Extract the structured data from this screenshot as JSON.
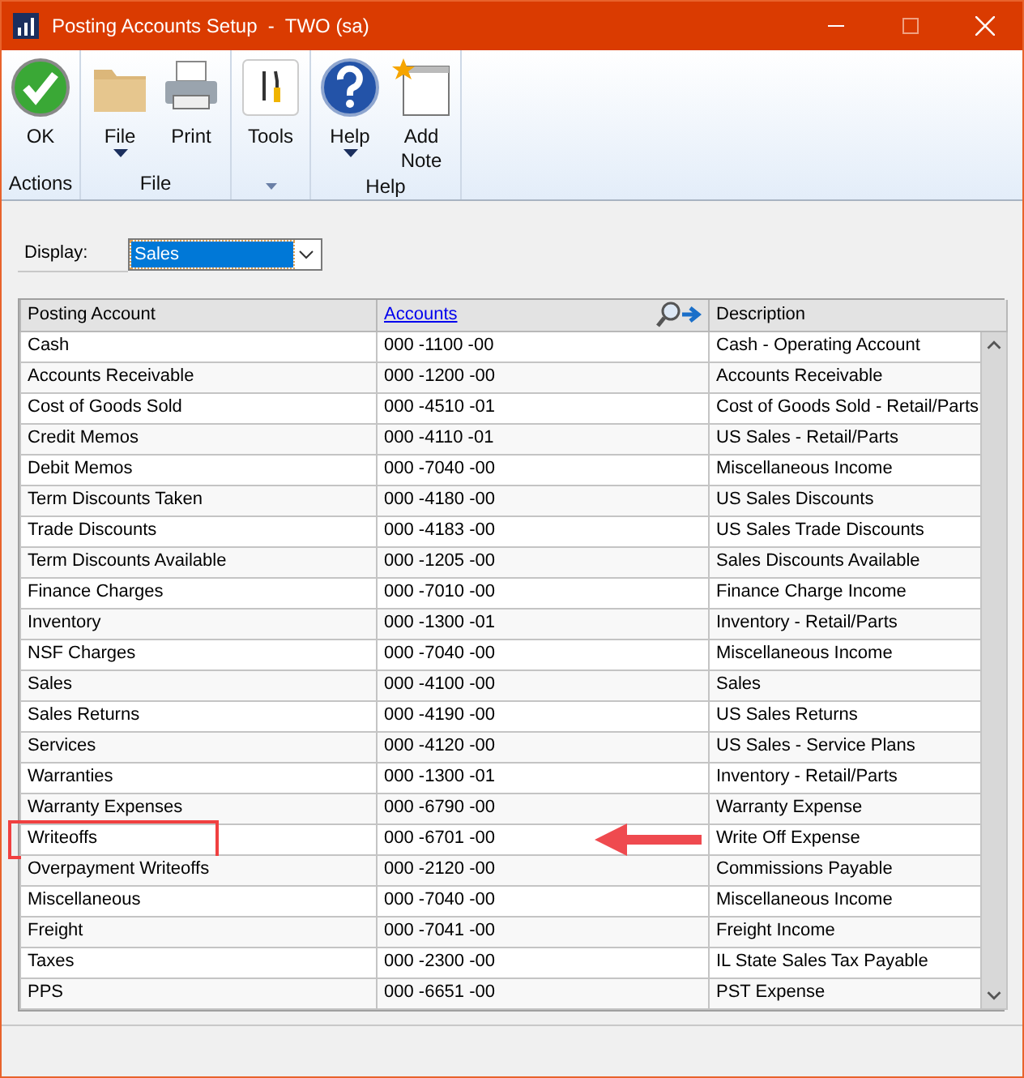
{
  "window": {
    "title": "Posting Accounts Setup  -  TWO (sa)"
  },
  "ribbon": [
    {
      "label": "Actions",
      "buttons": [
        {
          "kind": "ok",
          "label": "OK",
          "dropdown": false
        }
      ]
    },
    {
      "label": "File",
      "buttons": [
        {
          "kind": "folder",
          "label": "File",
          "dropdown": true
        },
        {
          "kind": "printer",
          "label": "Print",
          "dropdown": false
        }
      ]
    },
    {
      "kind": "caret",
      "buttons": [
        {
          "kind": "tools",
          "label": "Tools",
          "dropdown": false
        }
      ]
    },
    {
      "label": "Help",
      "buttons": [
        {
          "kind": "help",
          "label": "Help",
          "dropdown": true
        },
        {
          "kind": "note",
          "label": "Add\nNote",
          "dropdown": false
        }
      ]
    }
  ],
  "display": {
    "label": "Display:",
    "value": "Sales"
  },
  "table": {
    "columns": [
      "Posting Account",
      "Accounts",
      "Description"
    ],
    "rows": [
      {
        "account": "Cash",
        "number": "000 -1100 -00",
        "description": "Cash - Operating Account",
        "highlighted": false
      },
      {
        "account": "Accounts Receivable",
        "number": "000 -1200 -00",
        "description": "Accounts Receivable",
        "highlighted": false
      },
      {
        "account": "Cost of Goods Sold",
        "number": "000 -4510 -01",
        "description": "Cost of Goods Sold - Retail/Parts",
        "highlighted": false
      },
      {
        "account": "Credit Memos",
        "number": "000 -4110 -01",
        "description": "US Sales - Retail/Parts",
        "highlighted": false
      },
      {
        "account": "Debit Memos",
        "number": "000 -7040 -00",
        "description": "Miscellaneous Income",
        "highlighted": false
      },
      {
        "account": "Term Discounts Taken",
        "number": "000 -4180 -00",
        "description": "US Sales Discounts",
        "highlighted": false
      },
      {
        "account": "Trade Discounts",
        "number": "000 -4183 -00",
        "description": "US Sales Trade Discounts",
        "highlighted": false
      },
      {
        "account": "Term Discounts Available",
        "number": "000 -1205 -00",
        "description": "Sales Discounts Available",
        "highlighted": false
      },
      {
        "account": "Finance Charges",
        "number": "000 -7010 -00",
        "description": "Finance Charge Income",
        "highlighted": false
      },
      {
        "account": "Inventory",
        "number": "000 -1300 -01",
        "description": "Inventory - Retail/Parts",
        "highlighted": false
      },
      {
        "account": "NSF Charges",
        "number": "000 -7040 -00",
        "description": "Miscellaneous Income",
        "highlighted": false
      },
      {
        "account": "Sales",
        "number": "000 -4100 -00",
        "description": "Sales",
        "highlighted": false
      },
      {
        "account": "Sales Returns",
        "number": "000 -4190 -00",
        "description": "US Sales Returns",
        "highlighted": false
      },
      {
        "account": "Services",
        "number": "000 -4120 -00",
        "description": "US Sales - Service Plans",
        "highlighted": false
      },
      {
        "account": "Warranties",
        "number": "000 -1300 -01",
        "description": "Inventory - Retail/Parts",
        "highlighted": false
      },
      {
        "account": "Warranty Expenses",
        "number": "000 -6790 -00",
        "description": "Warranty Expense",
        "highlighted": false
      },
      {
        "account": "Writeoffs",
        "number": "000 -6701 -00",
        "description": "Write Off Expense",
        "highlighted": true
      },
      {
        "account": "Overpayment Writeoffs",
        "number": "000 -2120 -00",
        "description": "Commissions Payable",
        "highlighted": false
      },
      {
        "account": "Miscellaneous",
        "number": "000 -7040 -00",
        "description": "Miscellaneous Income",
        "highlighted": false
      },
      {
        "account": "Freight",
        "number": "000 -7041 -00",
        "description": "Freight Income",
        "highlighted": false
      },
      {
        "account": "Taxes",
        "number": "000 -2300 -00",
        "description": "IL State Sales Tax Payable",
        "highlighted": false
      },
      {
        "account": "PPS",
        "number": "000 -6651 -00",
        "description": "PST Expense",
        "highlighted": false
      }
    ]
  }
}
